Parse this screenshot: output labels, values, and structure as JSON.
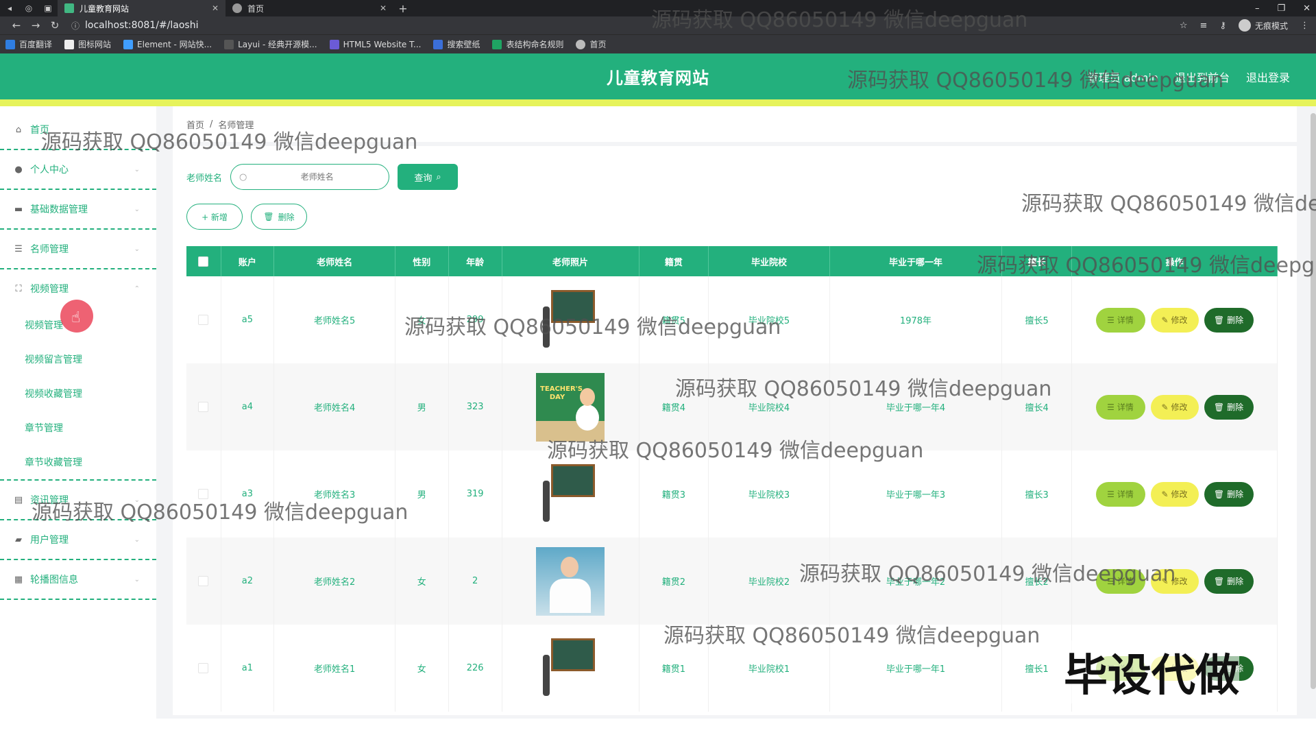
{
  "browser": {
    "tabs": [
      {
        "title": "儿童教育网站",
        "active": true
      },
      {
        "title": "首页",
        "active": false
      }
    ],
    "url": "localhost:8081/#/laoshi",
    "incognito_label": "无痕模式",
    "bookmarks": [
      "百度翻译",
      "图标网站",
      "Element - 网站快...",
      "Layui - 经典开源模...",
      "HTML5 Website T...",
      "搜索壁纸",
      "表结构命名规则",
      "首页"
    ]
  },
  "header": {
    "title": "儿童教育网站",
    "admin_label": "管理员 admin",
    "to_front_label": "退出到前台",
    "logout_label": "退出登录"
  },
  "sidebar": {
    "items": [
      {
        "label": "首页",
        "icon": "home-icon"
      },
      {
        "label": "个人中心",
        "icon": "user-icon"
      },
      {
        "label": "基础数据管理",
        "icon": "chat-icon"
      },
      {
        "label": "名师管理",
        "icon": "list-icon"
      },
      {
        "label": "视频管理",
        "icon": "expand-icon",
        "submenu": [
          "视频管理",
          "视频留言管理",
          "视频收藏管理",
          "章节管理",
          "章节收藏管理"
        ]
      },
      {
        "label": "资讯管理",
        "icon": "news-icon"
      },
      {
        "label": "用户管理",
        "icon": "users-icon"
      },
      {
        "label": "轮播图信息",
        "icon": "grid-icon"
      }
    ]
  },
  "breadcrumb": [
    "首页",
    "名师管理"
  ],
  "search": {
    "label": "老师姓名",
    "placeholder": "老师姓名",
    "query_label": "查询"
  },
  "actions": {
    "add_label": "+ 新增",
    "delete_label": "删除"
  },
  "table": {
    "columns": [
      "账户",
      "老师姓名",
      "性别",
      "年龄",
      "老师照片",
      "籍贯",
      "毕业院校",
      "毕业于哪一年",
      "擅长",
      "操作"
    ],
    "rows": [
      {
        "account": "a5",
        "name": "老师姓名5",
        "gender": "女",
        "age": "299",
        "photo": "chalkboard-teacher",
        "origin": "籍贯5",
        "school": "毕业院校5",
        "year": "1978年",
        "skill": "擅长5"
      },
      {
        "account": "a4",
        "name": "老师姓名4",
        "gender": "男",
        "age": "323",
        "photo": "teachers-day",
        "origin": "籍贯4",
        "school": "毕业院校4",
        "year": "毕业于哪一年4",
        "skill": "擅长4"
      },
      {
        "account": "a3",
        "name": "老师姓名3",
        "gender": "男",
        "age": "319",
        "photo": "chalkboard-teacher",
        "origin": "籍贯3",
        "school": "毕业院校3",
        "year": "毕业于哪一年3",
        "skill": "擅长3"
      },
      {
        "account": "a2",
        "name": "老师姓名2",
        "gender": "女",
        "age": "2",
        "photo": "man-at-desk",
        "origin": "籍贯2",
        "school": "毕业院校2",
        "year": "毕业于哪一年2",
        "skill": "擅长2"
      },
      {
        "account": "a1",
        "name": "老师姓名1",
        "gender": "女",
        "age": "226",
        "photo": "chalkboard-teacher",
        "origin": "籍贯1",
        "school": "毕业院校1",
        "year": "毕业于哪一年1",
        "skill": "擅长1"
      }
    ],
    "op_labels": {
      "detail": "详情",
      "edit": "修改",
      "delete": "删除"
    }
  },
  "watermark": {
    "text": "源码获取 QQ86050149 微信deepguan",
    "big_text": "毕设代做"
  },
  "colors": {
    "primary": "#23b07d",
    "accent_strip": "#e6f35b",
    "detail": "#a0d33f",
    "edit": "#f3ef55",
    "delete": "#1f6b2a"
  }
}
